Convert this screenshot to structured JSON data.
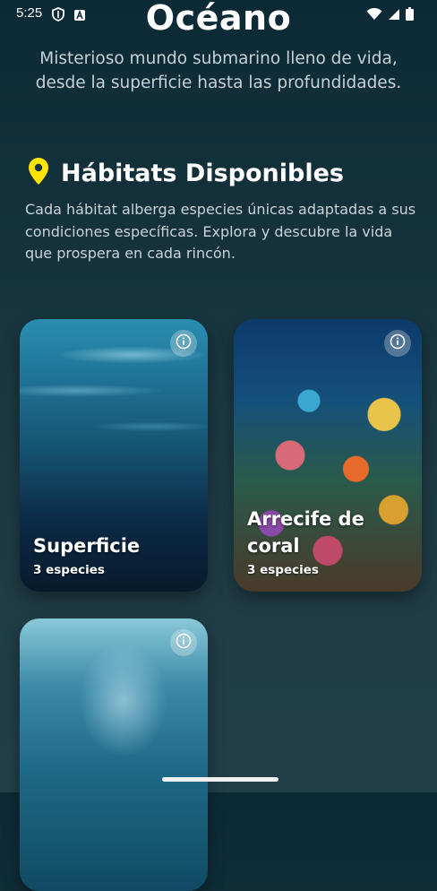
{
  "status_bar": {
    "time": "5:25"
  },
  "page": {
    "title": "Océano",
    "subtitle": "Misterioso mundo submarino lleno de vida, desde la superficie hasta las profundidades."
  },
  "section": {
    "title": "Hábitats Disponibles",
    "description": "Cada hábitat alberga especies únicas adaptadas a sus condiciones específicas. Explora y descubre la vida que prospera en cada rincón.",
    "icon": "location-pin-icon",
    "accent_color": "#ffe600"
  },
  "habitats": [
    {
      "title": "Superficie",
      "count": "3 especies",
      "image": "ocean-surface-image"
    },
    {
      "title": "Arrecife de coral",
      "count": "3 especies",
      "image": "coral-reef-image"
    },
    {
      "title": "",
      "count": "",
      "image": "deep-water-image"
    }
  ]
}
